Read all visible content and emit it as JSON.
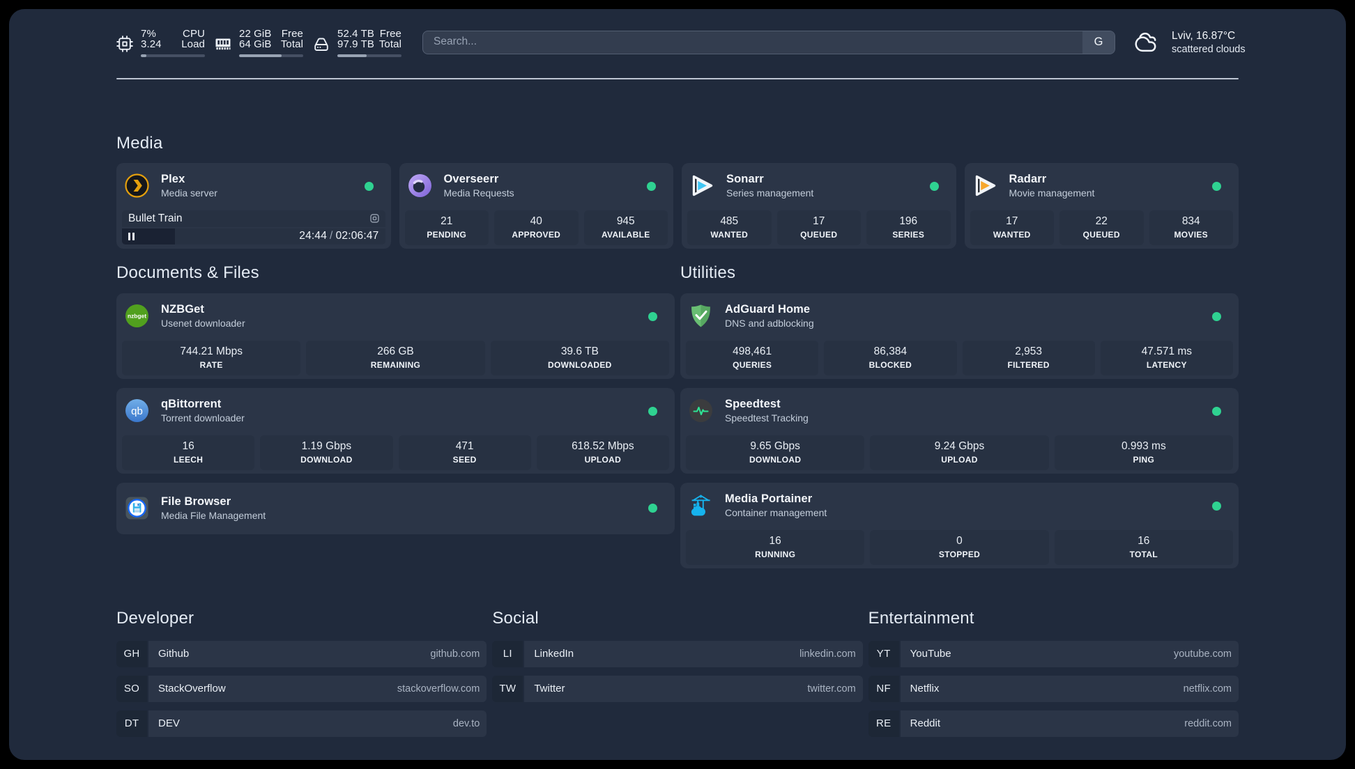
{
  "colors": {
    "background": "#202a3c",
    "card": "#2b3547",
    "status_online": "#2fd291",
    "speedtest_accent": "#2ee394",
    "plex_brand": "#e5a00d",
    "sonarr_brand": "#3fc6f4",
    "radarr_brand": "#f7a72c",
    "nzbget_brand": "#4f9f1f",
    "qbittorrent_brand": "#4a90d9",
    "adguard_brand": "#68bd72",
    "portainer_brand": "#0db7ed"
  },
  "topbar": {
    "resources": [
      {
        "name": "cpu",
        "icon": "cpu-icon",
        "rows": [
          {
            "left": "7%",
            "right": "CPU"
          },
          {
            "left": "3.24",
            "right": "Load"
          }
        ],
        "progress_pct": 9
      },
      {
        "name": "memory",
        "icon": "memory-icon",
        "rows": [
          {
            "left": "22 GiB",
            "right": "Free"
          },
          {
            "left": "64 GiB",
            "right": "Total"
          }
        ],
        "progress_pct": 66
      },
      {
        "name": "disk",
        "icon": "disk-icon",
        "rows": [
          {
            "left": "52.4 TB",
            "right": "Free"
          },
          {
            "left": "97.9 TB",
            "right": "Total"
          }
        ],
        "progress_pct": 46
      }
    ],
    "search": {
      "placeholder": "Search...",
      "provider_button": "G"
    },
    "weather": {
      "location": "Lviv, 16.87°C",
      "condition": "scattered clouds"
    }
  },
  "media": {
    "title": "Media",
    "plex": {
      "title": "Plex",
      "subtitle": "Media server",
      "status": "online",
      "now_playing": "Bullet Train",
      "elapsed": "24:44",
      "separator": "/",
      "duration": "02:06:47",
      "progress_pct": 20
    },
    "overseerr": {
      "title": "Overseerr",
      "subtitle": "Media Requests",
      "status": "online",
      "stats": [
        {
          "value": "21",
          "label": "PENDING"
        },
        {
          "value": "40",
          "label": "APPROVED"
        },
        {
          "value": "945",
          "label": "AVAILABLE"
        }
      ]
    },
    "sonarr": {
      "title": "Sonarr",
      "subtitle": "Series management",
      "status": "online",
      "stats": [
        {
          "value": "485",
          "label": "WANTED"
        },
        {
          "value": "17",
          "label": "QUEUED"
        },
        {
          "value": "196",
          "label": "SERIES"
        }
      ]
    },
    "radarr": {
      "title": "Radarr",
      "subtitle": "Movie management",
      "status": "online",
      "stats": [
        {
          "value": "17",
          "label": "WANTED"
        },
        {
          "value": "22",
          "label": "QUEUED"
        },
        {
          "value": "834",
          "label": "MOVIES"
        }
      ]
    }
  },
  "documents": {
    "title": "Documents & Files",
    "nzbget": {
      "title": "NZBGet",
      "subtitle": "Usenet downloader",
      "status": "online",
      "stats": [
        {
          "value": "744.21 Mbps",
          "label": "RATE"
        },
        {
          "value": "266 GB",
          "label": "REMAINING"
        },
        {
          "value": "39.6 TB",
          "label": "DOWNLOADED"
        }
      ]
    },
    "qbittorrent": {
      "title": "qBittorrent",
      "subtitle": "Torrent downloader",
      "status": "online",
      "stats": [
        {
          "value": "16",
          "label": "LEECH"
        },
        {
          "value": "1.19 Gbps",
          "label": "DOWNLOAD"
        },
        {
          "value": "471",
          "label": "SEED"
        },
        {
          "value": "618.52 Mbps",
          "label": "UPLOAD"
        }
      ]
    },
    "filebrowser": {
      "title": "File Browser",
      "subtitle": "Media File Management",
      "status": "online"
    }
  },
  "utilities": {
    "title": "Utilities",
    "adguard": {
      "title": "AdGuard Home",
      "subtitle": "DNS and adblocking",
      "status": "online",
      "stats": [
        {
          "value": "498,461",
          "label": "QUERIES"
        },
        {
          "value": "86,384",
          "label": "BLOCKED"
        },
        {
          "value": "2,953",
          "label": "FILTERED"
        },
        {
          "value": "47.571 ms",
          "label": "LATENCY"
        }
      ]
    },
    "speedtest": {
      "title": "Speedtest",
      "subtitle": "Speedtest Tracking",
      "status": "online",
      "stats": [
        {
          "value": "9.65 Gbps",
          "label": "DOWNLOAD"
        },
        {
          "value": "9.24 Gbps",
          "label": "UPLOAD"
        },
        {
          "value": "0.993 ms",
          "label": "PING"
        }
      ]
    },
    "portainer": {
      "title": "Media Portainer",
      "subtitle": "Container management",
      "status": "online",
      "stats": [
        {
          "value": "16",
          "label": "RUNNING"
        },
        {
          "value": "0",
          "label": "STOPPED"
        },
        {
          "value": "16",
          "label": "TOTAL"
        }
      ]
    }
  },
  "bookmarks": [
    {
      "title": "Developer",
      "items": [
        {
          "abbr": "GH",
          "name": "Github",
          "url": "github.com"
        },
        {
          "abbr": "SO",
          "name": "StackOverflow",
          "url": "stackoverflow.com"
        },
        {
          "abbr": "DT",
          "name": "DEV",
          "url": "dev.to"
        }
      ]
    },
    {
      "title": "Social",
      "items": [
        {
          "abbr": "LI",
          "name": "LinkedIn",
          "url": "linkedin.com"
        },
        {
          "abbr": "TW",
          "name": "Twitter",
          "url": "twitter.com"
        }
      ]
    },
    {
      "title": "Entertainment",
      "items": [
        {
          "abbr": "YT",
          "name": "YouTube",
          "url": "youtube.com"
        },
        {
          "abbr": "NF",
          "name": "Netflix",
          "url": "netflix.com"
        },
        {
          "abbr": "RE",
          "name": "Reddit",
          "url": "reddit.com"
        }
      ]
    }
  ]
}
